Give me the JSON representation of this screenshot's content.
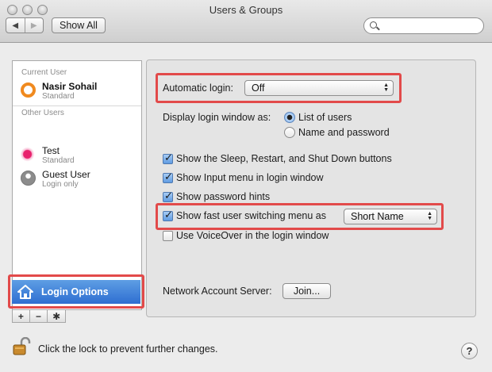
{
  "window": {
    "title": "Users & Groups"
  },
  "toolbar": {
    "back_icon": "chevron-left-icon",
    "forward_icon": "chevron-right-icon",
    "show_all_label": "Show All",
    "search_placeholder": ""
  },
  "sidebar": {
    "current_user_label": "Current User",
    "current_user": {
      "name": "Nasir Sohail",
      "role": "Standard"
    },
    "other_users_label": "Other Users",
    "other_users": [
      {
        "name": "Test",
        "role": "Standard"
      },
      {
        "name": "Guest User",
        "role": "Login only"
      }
    ],
    "login_options_label": "Login Options",
    "add_label": "+",
    "remove_label": "−",
    "action_label": "✱"
  },
  "options": {
    "automatic_login_label": "Automatic login:",
    "automatic_login_value": "Off",
    "display_login_label": "Display login window as:",
    "display_options": [
      {
        "label": "List of users",
        "selected": true
      },
      {
        "label": "Name and password",
        "selected": false
      }
    ],
    "checkboxes": [
      {
        "label": "Show the Sleep, Restart, and Shut Down buttons",
        "checked": true
      },
      {
        "label": "Show Input menu in login window",
        "checked": true
      },
      {
        "label": "Show password hints",
        "checked": true
      },
      {
        "label": "Show fast user switching menu as",
        "checked": true
      },
      {
        "label": "Use VoiceOver in the login window",
        "checked": false
      }
    ],
    "fast_switch_value": "Short Name",
    "network_server_label": "Network Account Server:",
    "join_label": "Join..."
  },
  "footer": {
    "lock_text": "Click the lock to prevent further changes.",
    "help_label": "?"
  },
  "colors": {
    "highlight": "#e24a4a",
    "selection": "#3a7bd5"
  }
}
